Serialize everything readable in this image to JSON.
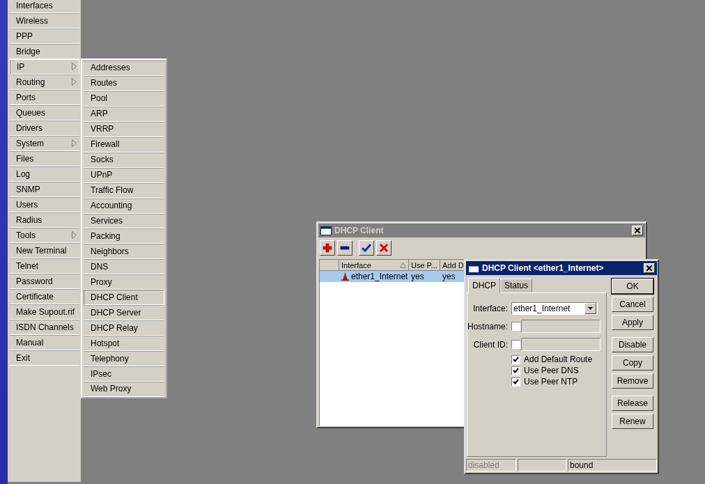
{
  "sidebar": {
    "items": [
      {
        "label": "Interfaces",
        "submenu": false,
        "selected": false
      },
      {
        "label": "Wireless",
        "submenu": false,
        "selected": false
      },
      {
        "label": "PPP",
        "submenu": false,
        "selected": false
      },
      {
        "label": "Bridge",
        "submenu": false,
        "selected": false
      },
      {
        "label": "IP",
        "submenu": true,
        "selected": true
      },
      {
        "label": "Routing",
        "submenu": true,
        "selected": false
      },
      {
        "label": "Ports",
        "submenu": false,
        "selected": false
      },
      {
        "label": "Queues",
        "submenu": false,
        "selected": false
      },
      {
        "label": "Drivers",
        "submenu": false,
        "selected": false
      },
      {
        "label": "System",
        "submenu": true,
        "selected": false
      },
      {
        "label": "Files",
        "submenu": false,
        "selected": false
      },
      {
        "label": "Log",
        "submenu": false,
        "selected": false
      },
      {
        "label": "SNMP",
        "submenu": false,
        "selected": false
      },
      {
        "label": "Users",
        "submenu": false,
        "selected": false
      },
      {
        "label": "Radius",
        "submenu": false,
        "selected": false
      },
      {
        "label": "Tools",
        "submenu": true,
        "selected": false
      },
      {
        "label": "New Terminal",
        "submenu": false,
        "selected": false
      },
      {
        "label": "Telnet",
        "submenu": false,
        "selected": false
      },
      {
        "label": "Password",
        "submenu": false,
        "selected": false
      },
      {
        "label": "Certificate",
        "submenu": false,
        "selected": false
      },
      {
        "label": "Make Supout.rif",
        "submenu": false,
        "selected": false
      },
      {
        "label": "ISDN Channels",
        "submenu": false,
        "selected": false
      },
      {
        "label": "Manual",
        "submenu": false,
        "selected": false
      },
      {
        "label": "Exit",
        "submenu": false,
        "selected": false
      }
    ]
  },
  "submenu": {
    "items": [
      {
        "label": "Addresses",
        "selected": false
      },
      {
        "label": "Routes",
        "selected": false
      },
      {
        "label": "Pool",
        "selected": false
      },
      {
        "label": "ARP",
        "selected": false
      },
      {
        "label": "VRRP",
        "selected": false
      },
      {
        "label": "Firewall",
        "selected": false
      },
      {
        "label": "Socks",
        "selected": false
      },
      {
        "label": "UPnP",
        "selected": false
      },
      {
        "label": "Traffic Flow",
        "selected": false
      },
      {
        "label": "Accounting",
        "selected": false
      },
      {
        "label": "Services",
        "selected": false
      },
      {
        "label": "Packing",
        "selected": false
      },
      {
        "label": "Neighbors",
        "selected": false
      },
      {
        "label": "DNS",
        "selected": false
      },
      {
        "label": "Proxy",
        "selected": false
      },
      {
        "label": "DHCP Client",
        "selected": true
      },
      {
        "label": "DHCP Server",
        "selected": false
      },
      {
        "label": "DHCP Relay",
        "selected": false
      },
      {
        "label": "Hotspot",
        "selected": false
      },
      {
        "label": "Telephony",
        "selected": false
      },
      {
        "label": "IPsec",
        "selected": false
      },
      {
        "label": "Web Proxy",
        "selected": false
      }
    ]
  },
  "main_window": {
    "title": "DHCP Client",
    "active": false,
    "toolbar": [
      {
        "kind": "add"
      },
      {
        "kind": "remove"
      },
      {
        "kind": "enable"
      },
      {
        "kind": "disable"
      }
    ],
    "table": {
      "columns": [
        {
          "label": "Interface",
          "sorted": true
        },
        {
          "label": "Use P...",
          "sorted": false
        },
        {
          "label": "Add D"
        }
      ],
      "rows": [
        {
          "cells": [
            "ether1_Internet",
            "yes",
            "yes"
          ],
          "selected": true
        }
      ]
    }
  },
  "dialog": {
    "title": "DHCP Client <ether1_Internet>",
    "active": true,
    "tabs": [
      {
        "label": "DHCP",
        "selected": true
      },
      {
        "label": "Status",
        "selected": false
      }
    ],
    "fields": [
      {
        "kind": "dropdown",
        "label": "Interface:",
        "value": "ether1_Internet"
      },
      {
        "kind": "checked-text",
        "label": "Hostname:",
        "checked": false
      },
      {
        "kind": "checked-text",
        "label": "Client ID:",
        "checked": false
      },
      {
        "kind": "checkbox",
        "label": "Add Default Route",
        "checked": true
      },
      {
        "kind": "checkbox",
        "label": "Use Peer DNS",
        "checked": true
      },
      {
        "kind": "checkbox",
        "label": "Use Peer NTP",
        "checked": true
      }
    ],
    "button_groups": [
      [
        {
          "label": "OK",
          "default": true
        },
        {
          "label": "Cancel",
          "default": false
        },
        {
          "label": "Apply",
          "default": false
        }
      ],
      [
        {
          "label": "Disable",
          "default": false
        },
        {
          "label": "Copy",
          "default": false
        },
        {
          "label": "Remove",
          "default": false
        }
      ],
      [
        {
          "label": "Release",
          "default": false
        },
        {
          "label": "Renew",
          "default": false
        }
      ]
    ],
    "status_bar": [
      {
        "kind": "text",
        "text": "disabled",
        "greyed": true
      },
      {
        "kind": "empty"
      },
      {
        "kind": "text",
        "text": "bound",
        "greyed": false
      }
    ]
  }
}
